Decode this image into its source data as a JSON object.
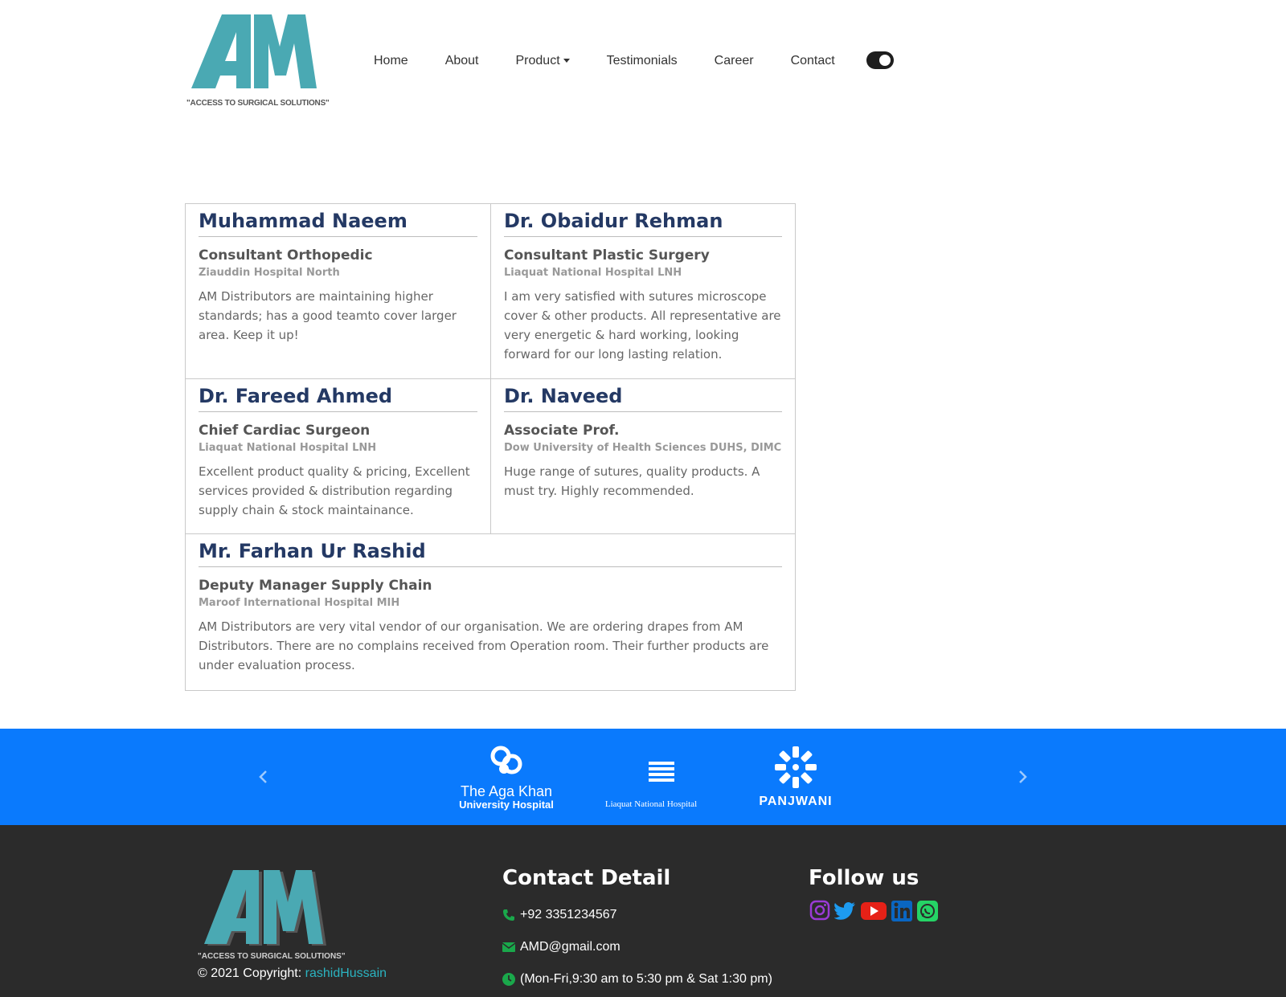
{
  "brand": {
    "tagline": "\"ACCESS TO SURGICAL SOLUTIONS\"",
    "teal": "#4aa9b3"
  },
  "nav": {
    "items": [
      {
        "label": "Home"
      },
      {
        "label": "About"
      },
      {
        "label": "Product"
      },
      {
        "label": "Testimonials"
      },
      {
        "label": "Career"
      },
      {
        "label": "Contact"
      }
    ],
    "theme_toggle_on": true
  },
  "testimonials": [
    {
      "name": "Muhammad Naeem",
      "role": "Consultant Orthopedic",
      "hospital": "Ziauddin Hospital North",
      "quote": "AM Distributors are maintaining higher standards; has a good teamto cover larger area. Keep it up!"
    },
    {
      "name": "Dr. Obaidur Rehman",
      "role": "Consultant Plastic Surgery",
      "hospital": "Liaquat National Hospital LNH",
      "quote": "I am very satisfied with sutures microscope cover & other products. All representative are very energetic & hard working, looking forward for our long lasting relation."
    },
    {
      "name": "Dr. Fareed Ahmed",
      "role": "Chief Cardiac Surgeon",
      "hospital": "Liaquat National Hospital LNH",
      "quote": "Excellent product quality & pricing, Excellent services provided & distribution regarding supply chain & stock maintainance."
    },
    {
      "name": "Dr. Naveed",
      "role": "Associate Prof.",
      "hospital": "Dow University of Health Sciences DUHS, DIMC",
      "quote": "Huge range of sutures, quality products. A must try. Highly recommended."
    },
    {
      "name": "Mr. Farhan Ur Rashid",
      "role": "Deputy Manager Supply Chain",
      "hospital": "Maroof International Hospital MIH",
      "quote": "AM Distributors are very vital vendor of our organisation. We are ordering drapes from AM Distributors. There are no complains received from Operation room. Their further products are under evaluation process."
    }
  ],
  "partners": {
    "background": "#0a7afd",
    "logos": [
      {
        "line1": "The Aga Khan",
        "line2": "University Hospital",
        "icon": "aga-khan-emblem"
      },
      {
        "label": "Liaquat National Hospital",
        "icon": "crescent-lines-emblem"
      },
      {
        "label": "PANJWANI",
        "icon": "snowflake-emblem"
      }
    ]
  },
  "footer": {
    "background": "#2b2b2b",
    "copyright_prefix": "© 2021 Copyright: ",
    "copyright_author": "rashidHussain",
    "contact": {
      "heading": "Contact Detail",
      "phone": "+92 3351234567",
      "email": "AMD@gmail.com",
      "hours": "(Mon-Fri,9:30 am to 5:30 pm & Sat 1:30 pm)"
    },
    "follow": {
      "heading": "Follow us",
      "icons": [
        "instagram-icon",
        "twitter-icon",
        "youtube-icon",
        "linkedin-icon",
        "whatsapp-icon"
      ]
    }
  }
}
